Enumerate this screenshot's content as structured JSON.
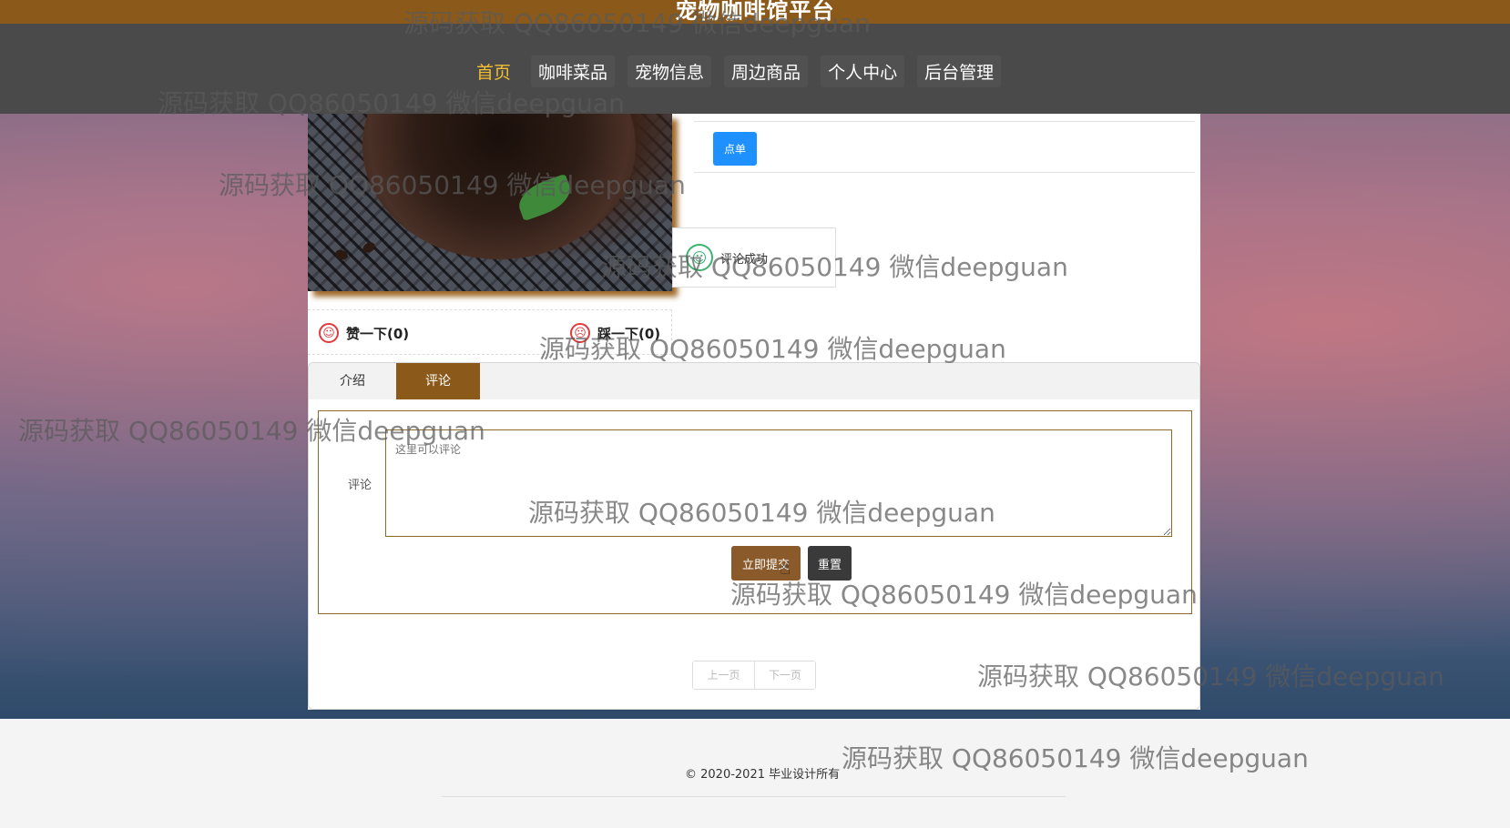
{
  "site": {
    "title": "宠物咖啡馆平台"
  },
  "nav": {
    "items": [
      {
        "label": "首页",
        "active": true
      },
      {
        "label": "咖啡菜品",
        "active": false
      },
      {
        "label": "宠物信息",
        "active": false
      },
      {
        "label": "周边商品",
        "active": false
      },
      {
        "label": "个人中心",
        "active": false
      },
      {
        "label": "后台管理",
        "active": false
      }
    ],
    "active_color": "#f2c030"
  },
  "product": {
    "order_button_label": "点单",
    "toast_message": "评论成功",
    "like_label": "赞一下(0)",
    "dislike_label": "踩一下(0)"
  },
  "tabs": [
    {
      "label": "介绍",
      "active": false
    },
    {
      "label": "评论",
      "active": true
    }
  ],
  "comment_form": {
    "label": "评论",
    "placeholder": "这里可以评论",
    "submit_label": "立即提交",
    "reset_label": "重置"
  },
  "pager": {
    "prev_label": "上一页",
    "next_label": "下一页"
  },
  "footer": {
    "copyright": "© 2020-2021 毕业设计所有"
  },
  "watermark_text": "源码获取 QQ86050149 微信deepguan",
  "colors": {
    "brand_brown": "#8b5a1a",
    "nav_bg": "#4a4a4a",
    "order_blue": "#1e90ff",
    "success_green": "#3cb371",
    "vote_red": "#e23a3a"
  }
}
